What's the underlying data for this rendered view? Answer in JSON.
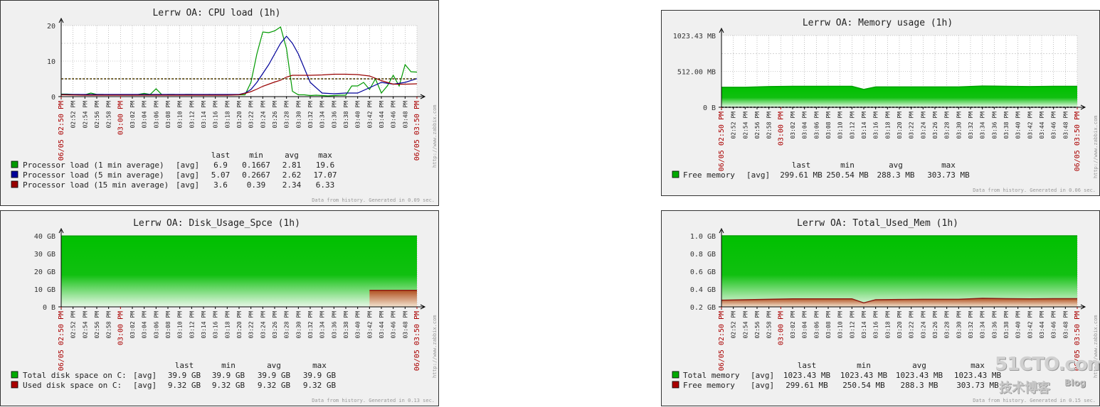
{
  "chart_data": [
    {
      "type": "line",
      "title": "Lerrw OA: CPU load (1h)",
      "y_ticks": [
        "0",
        "10",
        "20"
      ],
      "ylim": [
        0,
        20
      ],
      "trigger_line": 5,
      "grid": true,
      "x_ticks": [
        "06/05 02:50 PM",
        "02:52 PM",
        "02:54 PM",
        "02:56 PM",
        "02:58 PM",
        "03:00 PM",
        "03:02 PM",
        "03:04 PM",
        "03:06 PM",
        "03:08 PM",
        "03:10 PM",
        "03:12 PM",
        "03:14 PM",
        "03:16 PM",
        "03:18 PM",
        "03:20 PM",
        "03:22 PM",
        "03:24 PM",
        "03:26 PM",
        "03:28 PM",
        "03:30 PM",
        "03:32 PM",
        "03:34 PM",
        "03:36 PM",
        "03:38 PM",
        "03:40 PM",
        "03:42 PM",
        "03:44 PM",
        "03:46 PM",
        "03:48 PM",
        "06/05 03:50 PM"
      ],
      "red_ticks": [
        0,
        5,
        30
      ],
      "legend_header": [
        "last",
        "min",
        "avg",
        "max"
      ],
      "series": [
        {
          "name": "Processor load (1 min average)",
          "agg": "[avg]",
          "color": "#009900",
          "stats": [
            "6.9",
            "0.1667",
            "2.81",
            "19.6"
          ],
          "x": [
            0,
            1,
            2,
            3,
            4,
            5,
            6,
            7,
            8,
            9,
            10,
            11,
            12,
            13,
            14,
            15,
            16,
            17,
            18,
            19,
            20,
            21,
            22,
            23,
            24,
            25,
            26,
            27,
            28,
            29,
            30,
            31,
            32,
            33,
            34,
            35,
            36,
            37,
            38,
            39,
            40,
            41,
            42,
            43,
            44,
            45,
            46,
            47,
            48,
            49,
            50,
            51,
            52,
            53,
            54,
            55,
            56,
            57,
            58,
            59,
            60
          ],
          "values": [
            0.7,
            0.7,
            0.6,
            0.6,
            0.5,
            1.0,
            0.6,
            0.6,
            0.5,
            0.5,
            0.5,
            0.5,
            0.4,
            0.6,
            0.9,
            0.6,
            2.2,
            0.5,
            0.6,
            0.6,
            0.5,
            0.6,
            0.6,
            0.5,
            0.5,
            0.6,
            0.5,
            0.5,
            0.5,
            0.5,
            0.5,
            0.5,
            4.0,
            12.0,
            18.2,
            18.0,
            18.5,
            19.6,
            13.5,
            1.5,
            0.5,
            0.5,
            0.3,
            0.4,
            0.3,
            0.2,
            0.3,
            0.4,
            0.4,
            3.0,
            3.0,
            4.0,
            2.0,
            5.0,
            1.0,
            3.0,
            6.0,
            3.0,
            9.0,
            7.0,
            6.9
          ]
        },
        {
          "name": "Processor load (5 min average)",
          "agg": "[avg]",
          "color": "#000099",
          "stats": [
            "5.07",
            "0.2667",
            "2.62",
            "17.07"
          ],
          "x": [
            0,
            2,
            4,
            6,
            8,
            10,
            12,
            14,
            16,
            18,
            20,
            22,
            24,
            26,
            28,
            30,
            31,
            32,
            33,
            34,
            35,
            36,
            37,
            38,
            39,
            40,
            41,
            42,
            44,
            46,
            48,
            50,
            52,
            54,
            56,
            58,
            60
          ],
          "values": [
            0.6,
            0.6,
            0.6,
            0.6,
            0.6,
            0.6,
            0.6,
            0.6,
            0.6,
            0.6,
            0.6,
            0.6,
            0.6,
            0.6,
            0.6,
            0.6,
            1.0,
            2.0,
            4.0,
            6.5,
            9.0,
            12.0,
            15.0,
            17.0,
            15.0,
            12.0,
            8.0,
            4.0,
            1.0,
            0.8,
            1.0,
            1.0,
            2.5,
            4.0,
            3.5,
            4.0,
            5.07
          ]
        },
        {
          "name": "Processor load (15 min average)",
          "agg": "[avg]",
          "color": "#990000",
          "stats": [
            "3.6",
            "0.39",
            "2.34",
            "6.33"
          ],
          "x": [
            0,
            4,
            8,
            12,
            16,
            20,
            24,
            28,
            30,
            31,
            32,
            33,
            34,
            35,
            36,
            37,
            38,
            39,
            40,
            42,
            44,
            46,
            48,
            50,
            52,
            54,
            56,
            58,
            60
          ],
          "values": [
            0.5,
            0.4,
            0.4,
            0.4,
            0.4,
            0.4,
            0.4,
            0.4,
            0.5,
            0.9,
            1.4,
            2.1,
            2.9,
            3.5,
            4.1,
            4.6,
            5.5,
            6.0,
            6.0,
            6.0,
            6.1,
            6.3,
            6.3,
            6.2,
            5.8,
            4.5,
            3.5,
            3.5,
            3.6
          ]
        }
      ],
      "footer": "Data from history. Generated in 0.09 sec."
    },
    {
      "type": "area",
      "title": "Lerrw OA: Memory usage (1h)",
      "y_ticks": [
        "0 B",
        "512.00 MB",
        "1023.43 MB"
      ],
      "ylim": [
        0,
        1023.43
      ],
      "grid": true,
      "x_ticks": [
        "06/05 02:50 PM",
        "02:52 PM",
        "02:54 PM",
        "02:56 PM",
        "02:58 PM",
        "03:00 PM",
        "03:02 PM",
        "03:04 PM",
        "03:06 PM",
        "03:08 PM",
        "03:10 PM",
        "03:12 PM",
        "03:14 PM",
        "03:16 PM",
        "03:18 PM",
        "03:20 PM",
        "03:22 PM",
        "03:24 PM",
        "03:26 PM",
        "03:28 PM",
        "03:30 PM",
        "03:32 PM",
        "03:34 PM",
        "03:36 PM",
        "03:38 PM",
        "03:40 PM",
        "03:42 PM",
        "03:44 PM",
        "03:46 PM",
        "03:48 PM",
        "06/05 03:50 PM"
      ],
      "red_ticks": [
        0,
        5,
        30
      ],
      "legend_header": [
        "last",
        "min",
        "avg",
        "max"
      ],
      "series": [
        {
          "name": "Free memory",
          "agg": "[avg]",
          "color": "#00AA00",
          "stats": [
            "299.61 MB",
            "250.54 MB",
            "288.3 MB",
            "303.73 MB"
          ],
          "x": [
            0,
            4,
            8,
            12,
            16,
            20,
            22,
            24,
            26,
            30,
            34,
            38,
            40,
            44,
            48,
            52,
            56,
            60
          ],
          "values": [
            285,
            285,
            295,
            300,
            300,
            300,
            300,
            255,
            290,
            290,
            290,
            290,
            290,
            303,
            300,
            295,
            300,
            299.61
          ]
        }
      ],
      "footer": "Data from history. Generated in 0.06 sec."
    },
    {
      "type": "area",
      "title": "Lerrw OA: Disk_Usage_Spce (1h)",
      "y_ticks": [
        "0 B",
        "10 GB",
        "20 GB",
        "30 GB",
        "40 GB"
      ],
      "ylim": [
        0,
        40
      ],
      "grid": true,
      "x_ticks": [
        "06/05 02:50 PM",
        "02:52 PM",
        "02:54 PM",
        "02:56 PM",
        "02:58 PM",
        "03:00 PM",
        "03:02 PM",
        "03:04 PM",
        "03:06 PM",
        "03:08 PM",
        "03:10 PM",
        "03:12 PM",
        "03:14 PM",
        "03:16 PM",
        "03:18 PM",
        "03:20 PM",
        "03:22 PM",
        "03:24 PM",
        "03:26 PM",
        "03:28 PM",
        "03:30 PM",
        "03:32 PM",
        "03:34 PM",
        "03:36 PM",
        "03:38 PM",
        "03:40 PM",
        "03:42 PM",
        "03:44 PM",
        "03:46 PM",
        "03:48 PM",
        "06/05 03:50 PM"
      ],
      "red_ticks": [
        0,
        5,
        30
      ],
      "legend_header": [
        "last",
        "min",
        "avg",
        "max"
      ],
      "series": [
        {
          "name": "Total disk space on C:",
          "agg": "[avg]",
          "color": "#00AA00",
          "stats": [
            "39.9 GB",
            "39.9 GB",
            "39.9 GB",
            "39.9 GB"
          ],
          "x": [
            0,
            60
          ],
          "values": [
            39.9,
            39.9
          ]
        },
        {
          "name": "Used disk space on C:",
          "agg": "[avg]",
          "color": "#AA0000",
          "stats": [
            "9.32 GB",
            "9.32 GB",
            "9.32 GB",
            "9.32 GB"
          ],
          "x": [
            52,
            60
          ],
          "values": [
            9.32,
            9.32
          ]
        }
      ],
      "footer": "Data from history. Generated in 0.13 sec."
    },
    {
      "type": "area",
      "title": "Lerrw OA: Total_Used_Mem (1h)",
      "y_ticks": [
        "0.2 GB",
        "0.4 GB",
        "0.6 GB",
        "0.8 GB",
        "1.0 GB"
      ],
      "ylim": [
        0.2,
        1.0
      ],
      "grid": true,
      "x_ticks": [
        "06/05 02:50 PM",
        "02:52 PM",
        "02:54 PM",
        "02:56 PM",
        "02:58 PM",
        "03:00 PM",
        "03:02 PM",
        "03:04 PM",
        "03:06 PM",
        "03:08 PM",
        "03:10 PM",
        "03:12 PM",
        "03:14 PM",
        "03:16 PM",
        "03:18 PM",
        "03:20 PM",
        "03:22 PM",
        "03:24 PM",
        "03:26 PM",
        "03:28 PM",
        "03:30 PM",
        "03:32 PM",
        "03:34 PM",
        "03:36 PM",
        "03:38 PM",
        "03:40 PM",
        "03:42 PM",
        "03:44 PM",
        "03:46 PM",
        "03:48 PM",
        "06/05 03:50 PM"
      ],
      "red_ticks": [
        0,
        5,
        30
      ],
      "legend_header": [
        "last",
        "min",
        "avg",
        "max"
      ],
      "series": [
        {
          "name": "Total memory",
          "agg": "[avg]",
          "color": "#00AA00",
          "stats": [
            "1023.43 MB",
            "1023.43 MB",
            "1023.43 MB",
            "1023.43 MB"
          ],
          "x": [
            0,
            60
          ],
          "values": [
            1.0,
            1.0
          ]
        },
        {
          "name": "Free memory",
          "agg": "[avg]",
          "color": "#AA0000",
          "stats": [
            "299.61 MB",
            "250.54 MB",
            "288.3 MB",
            "303.73 MB"
          ],
          "x": [
            0,
            4,
            8,
            12,
            16,
            20,
            22,
            24,
            26,
            30,
            34,
            38,
            40,
            44,
            48,
            52,
            56,
            60
          ],
          "values": [
            0.275,
            0.28,
            0.285,
            0.29,
            0.29,
            0.29,
            0.29,
            0.245,
            0.28,
            0.283,
            0.285,
            0.285,
            0.285,
            0.296,
            0.292,
            0.29,
            0.292,
            0.292
          ]
        }
      ],
      "footer": "Data from history. Generated in 0.15 sec."
    }
  ],
  "watermark": {
    "big": "51CTO.com",
    "small": "技术博客",
    "tag": "Blog"
  },
  "vendor_url": "http://www.zabbix.com"
}
